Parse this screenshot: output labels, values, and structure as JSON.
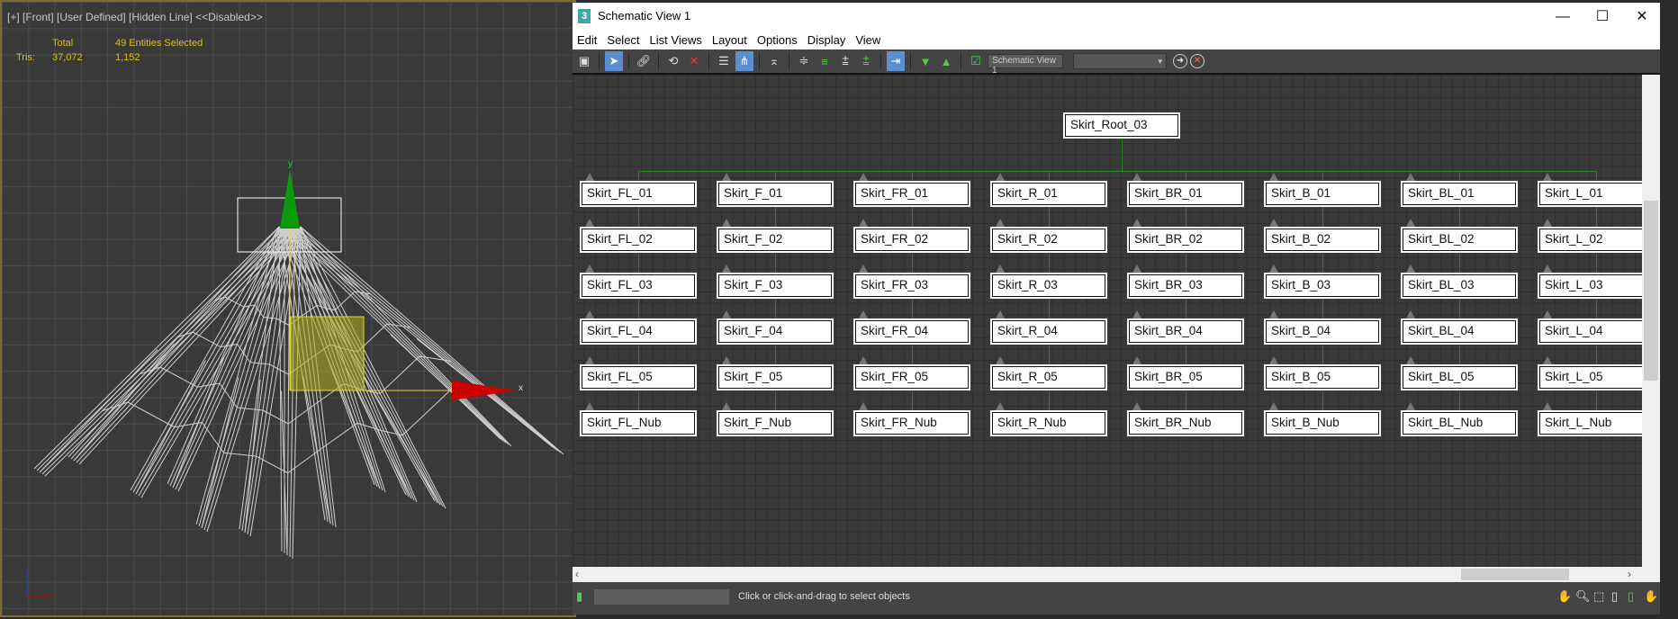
{
  "viewport": {
    "label": "[+] [Front] [User Defined] [Hidden Line]  <<Disabled>>",
    "stats": {
      "total_label": "Total",
      "selected_label": "49 Entities Selected",
      "tris_label": "Tris:",
      "tris_total": "37,072",
      "tris_selected": "1,152"
    },
    "axis_labels": {
      "x": "x",
      "y": "y"
    }
  },
  "window": {
    "app_icon": "3",
    "title": "Schematic View 1",
    "controls": {
      "minimize": "—",
      "maximize": "☐",
      "close": "✕"
    },
    "menu": [
      "Edit",
      "Select",
      "List Views",
      "Layout",
      "Options",
      "Display",
      "View"
    ],
    "toolbar": {
      "view_name": "Schematic View 1",
      "combo_value": "▾"
    },
    "status_text": "Click or click-and-drag to select objects"
  },
  "schematic": {
    "root": "Skirt_Root_03",
    "columns": [
      [
        "Skirt_FL_01",
        "Skirt_FL_02",
        "Skirt_FL_03",
        "Skirt_FL_04",
        "Skirt_FL_05",
        "Skirt_FL_Nub"
      ],
      [
        "Skirt_F_01",
        "Skirt_F_02",
        "Skirt_F_03",
        "Skirt_F_04",
        "Skirt_F_05",
        "Skirt_F_Nub"
      ],
      [
        "Skirt_FR_01",
        "Skirt_FR_02",
        "Skirt_FR_03",
        "Skirt_FR_04",
        "Skirt_FR_05",
        "Skirt_FR_Nub"
      ],
      [
        "Skirt_R_01",
        "Skirt_R_02",
        "Skirt_R_03",
        "Skirt_R_04",
        "Skirt_R_05",
        "Skirt_R_Nub"
      ],
      [
        "Skirt_BR_01",
        "Skirt_BR_02",
        "Skirt_BR_03",
        "Skirt_BR_04",
        "Skirt_BR_05",
        "Skirt_BR_Nub"
      ],
      [
        "Skirt_B_01",
        "Skirt_B_02",
        "Skirt_B_03",
        "Skirt_B_04",
        "Skirt_B_05",
        "Skirt_B_Nub"
      ],
      [
        "Skirt_BL_01",
        "Skirt_BL_02",
        "Skirt_BL_03",
        "Skirt_BL_04",
        "Skirt_BL_05",
        "Skirt_BL_Nub"
      ],
      [
        "Skirt_L_01",
        "Skirt_L_02",
        "Skirt_L_03",
        "Skirt_L_04",
        "Skirt_L_05",
        "Skirt_L_Nub"
      ]
    ],
    "wire_color": "#1d8a1d"
  }
}
